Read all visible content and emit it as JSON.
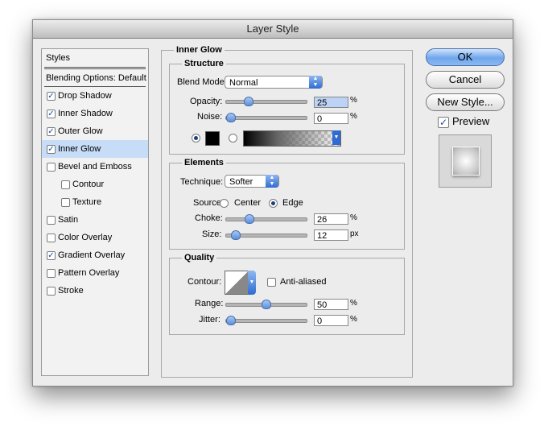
{
  "window": {
    "title": "Layer Style"
  },
  "sidebar": {
    "items": [
      {
        "label": "Styles",
        "checkbox": false,
        "checked": false,
        "selected": false
      },
      {
        "label": "Blending Options: Default",
        "checkbox": false,
        "checked": false,
        "selected": false
      },
      {
        "label": "Drop Shadow",
        "checkbox": true,
        "checked": true,
        "selected": false
      },
      {
        "label": "Inner Shadow",
        "checkbox": true,
        "checked": true,
        "selected": false
      },
      {
        "label": "Outer Glow",
        "checkbox": true,
        "checked": true,
        "selected": false
      },
      {
        "label": "Inner Glow",
        "checkbox": true,
        "checked": true,
        "selected": true
      },
      {
        "label": "Bevel and Emboss",
        "checkbox": true,
        "checked": false,
        "selected": false
      },
      {
        "label": "Contour",
        "checkbox": true,
        "checked": false,
        "selected": false
      },
      {
        "label": "Texture",
        "checkbox": true,
        "checked": false,
        "selected": false
      },
      {
        "label": "Satin",
        "checkbox": true,
        "checked": false,
        "selected": false
      },
      {
        "label": "Color Overlay",
        "checkbox": true,
        "checked": false,
        "selected": false
      },
      {
        "label": "Gradient Overlay",
        "checkbox": true,
        "checked": true,
        "selected": false
      },
      {
        "label": "Pattern Overlay",
        "checkbox": true,
        "checked": false,
        "selected": false
      },
      {
        "label": "Stroke",
        "checkbox": true,
        "checked": false,
        "selected": false
      }
    ]
  },
  "panel": {
    "title": "Inner Glow",
    "structure": {
      "title": "Structure",
      "blend_mode_label": "Blend Mode:",
      "blend_mode_value": "Normal",
      "opacity_label": "Opacity:",
      "opacity_value": "25",
      "opacity_unit": "%",
      "opacity_fraction": 0.25,
      "noise_label": "Noise:",
      "noise_value": "0",
      "noise_unit": "%",
      "noise_fraction": 0,
      "color_swatch": "#000000"
    },
    "elements": {
      "title": "Elements",
      "technique_label": "Technique:",
      "technique_value": "Softer",
      "source_label": "Source:",
      "source_center": "Center",
      "source_edge": "Edge",
      "choke_label": "Choke:",
      "choke_value": "26",
      "choke_unit": "%",
      "choke_fraction": 0.26,
      "size_label": "Size:",
      "size_value": "12",
      "size_unit": "px"
    },
    "quality": {
      "title": "Quality",
      "contour_label": "Contour:",
      "anti_aliased_label": "Anti-aliased",
      "range_label": "Range:",
      "range_value": "50",
      "range_unit": "%",
      "range_fraction": 0.5,
      "jitter_label": "Jitter:",
      "jitter_value": "0",
      "jitter_unit": "%",
      "jitter_fraction": 0
    }
  },
  "buttons": {
    "ok": "OK",
    "cancel": "Cancel",
    "new_style": "New Style...",
    "preview": "Preview"
  }
}
